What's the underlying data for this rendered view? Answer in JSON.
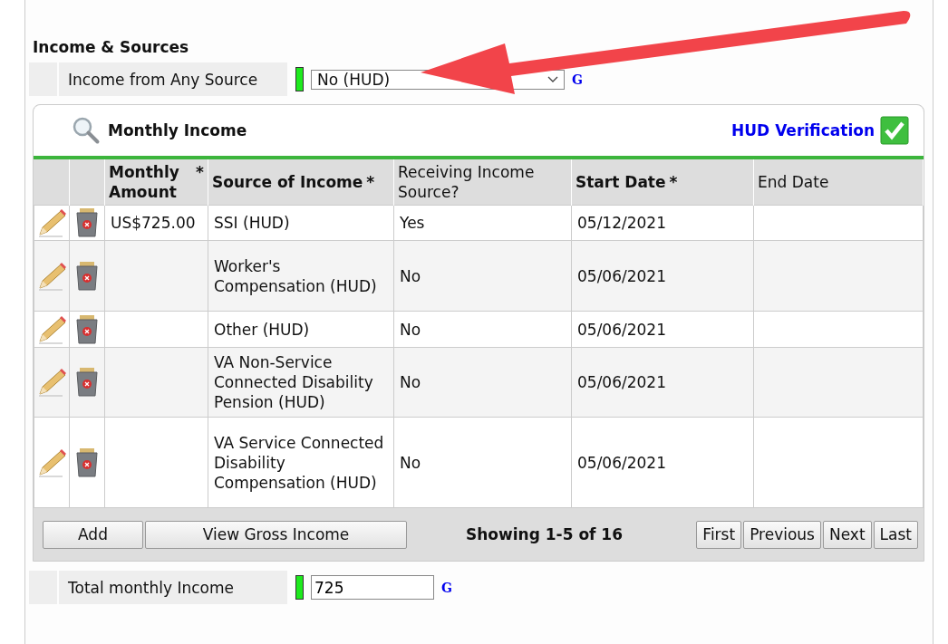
{
  "section_title": "Income & Sources",
  "income_field": {
    "label": "Income from Any Source",
    "value": "No (HUD)",
    "link": "G"
  },
  "panel": {
    "title": "Monthly Income",
    "verification_link": "HUD Verification",
    "verified": true,
    "columns": [
      {
        "kind": "icon"
      },
      {
        "kind": "icon"
      },
      {
        "label": "Monthly Amount",
        "bold": true,
        "mark": "*"
      },
      {
        "label": "Source of Income",
        "bold": true,
        "mark": "*"
      },
      {
        "label": "Receiving Income Source?",
        "bold": false
      },
      {
        "label": "Start Date",
        "bold": true,
        "mark": "*"
      },
      {
        "label": "End Date",
        "bold": false
      }
    ],
    "rows": [
      {
        "amount": "US$725.00",
        "source": "SSI (HUD)",
        "receiving": "Yes",
        "start_date": "05/12/2021"
      },
      {
        "source": "Worker's Compensation (HUD)",
        "receiving": "No",
        "start_date": "05/06/2021"
      },
      {
        "source": "Other (HUD)",
        "receiving": "No",
        "start_date": "05/06/2021"
      },
      {
        "source": "VA Non-Service Connected Disability Pension (HUD)",
        "receiving": "No",
        "start_date": "05/06/2021"
      },
      {
        "source": "VA Service Connected Disability Compensation (HUD)",
        "receiving": "No",
        "start_date": "05/06/2021"
      }
    ],
    "actions": [
      "Add",
      "View Gross Income"
    ],
    "paging_text": "Showing 1-5 of 16",
    "pager": [
      "First",
      "Previous",
      "Next",
      "Last"
    ]
  },
  "total_field": {
    "label": "Total monthly Income",
    "value": "725",
    "link": "G"
  }
}
